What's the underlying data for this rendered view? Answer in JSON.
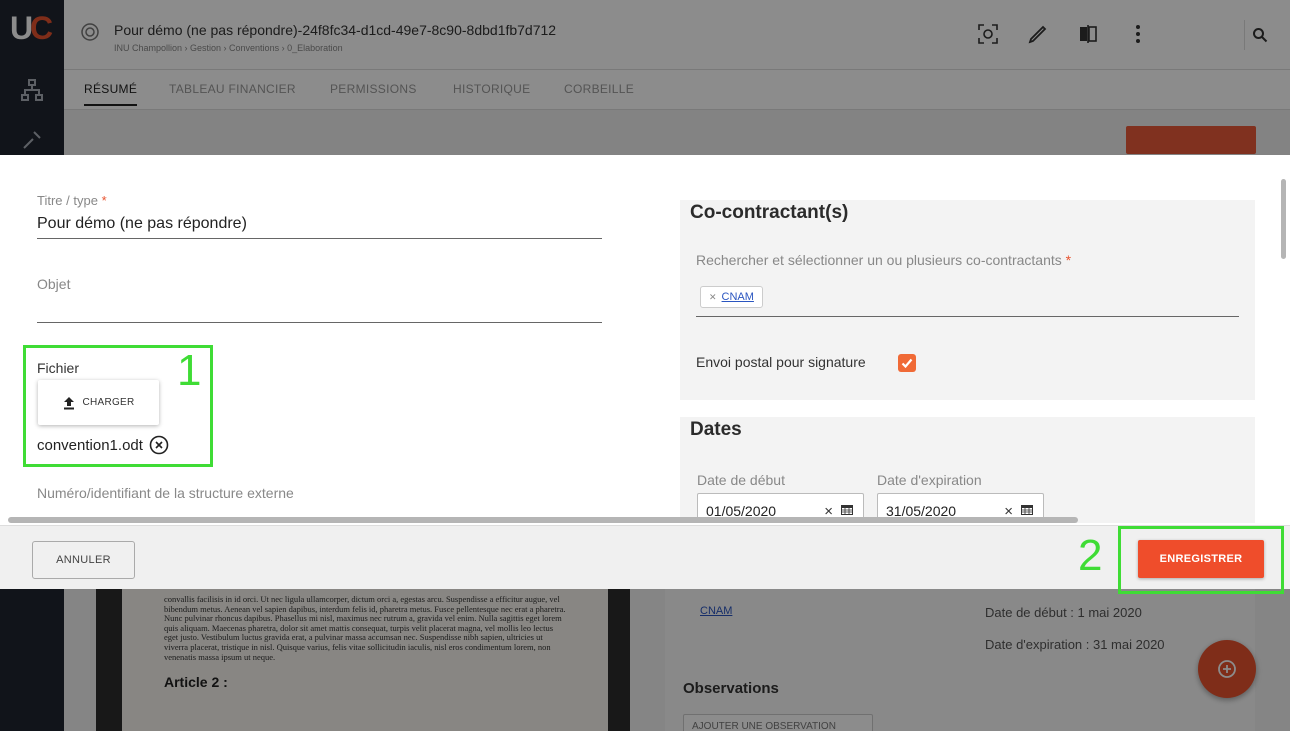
{
  "app": {
    "logo_text": "UC",
    "doc_title": "Pour démo (ne pas répondre)-24f8fc34-d1cd-49e7-8c90-8dbd1fb7d712",
    "breadcrumb": "INU Champollion › Gestion › Conventions › 0_Elaboration",
    "tabs": [
      "RÉSUMÉ",
      "TABLEAU FINANCIER",
      "PERMISSIONS",
      "HISTORIQUE",
      "CORBEILLE"
    ],
    "top_icons": [
      "focus-icon",
      "pencil-icon",
      "compare-icon",
      "more-vert-icon",
      "search-icon"
    ]
  },
  "background": {
    "doc_paragraph": "convallis facilisis in id orci. Ut nec ligula ullamcorper, dictum orci a, egestas arcu. Suspendisse a efficitur augue, vel bibendum metus. Aenean vel sapien dapibus, interdum felis id, pharetra metus. Fusce pellentesque nec erat a pharetra. Nunc pulvinar rhoncus dapibus. Phasellus mi nisl, maximus nec rutrum a, gravida vel enim. Nulla sagittis eget lorem quis aliquam. Maecenas pharetra, dolor sit amet mattis consequat, turpis velit placerat magna, vel mollis leo lectus eget justo. Vestibulum luctus gravida erat, a pulvinar massa accumsan nec. Suspendisse nibh sapien, ultricies ut viverra placerat, tristique in nisl. Quisque varius, felis vitae sollicitudin iaculis, nisl eros condimentum lorem, non venenatis massa ipsum ut neque.",
    "doc_heading": "Article 2 :",
    "cocontractant_link": "CNAM",
    "date_debut_text": "Date de début : 1 mai 2020",
    "date_expiration_text": "Date d'expiration : 31 mai 2020",
    "observations_title": "Observations",
    "observation_button": "AJOUTER UNE OBSERVATION"
  },
  "form": {
    "titre_label": "Titre / type",
    "required_mark": "*",
    "titre_value": "Pour démo (ne pas répondre)",
    "objet_label": "Objet",
    "objet_value": "",
    "fichier_label": "Fichier",
    "charger_label": "CHARGER",
    "file_name": "convention1.odt",
    "numero_label": "Numéro/identifiant de la structure externe"
  },
  "cocontractants": {
    "title": "Co-contractant(s)",
    "search_label": "Rechercher et sélectionner un ou plusieurs co-contractants",
    "chips": [
      "CNAM"
    ],
    "envoi_postal_label": "Envoi postal pour signature",
    "envoi_postal_checked": true
  },
  "dates": {
    "title": "Dates",
    "debut_label": "Date de début",
    "debut_value": "01/05/2020",
    "expiration_label": "Date d'expiration",
    "expiration_value": "31/05/2020",
    "clear_glyph": "×"
  },
  "footer": {
    "cancel_label": "ANNULER",
    "save_label": "ENREGISTRER"
  },
  "annotations": {
    "step_1": "1",
    "step_2": "2",
    "color": "#3fdc35"
  },
  "colors": {
    "accent": "#ef4d2b",
    "link": "#2a55c0",
    "rail": "#1f2530"
  }
}
